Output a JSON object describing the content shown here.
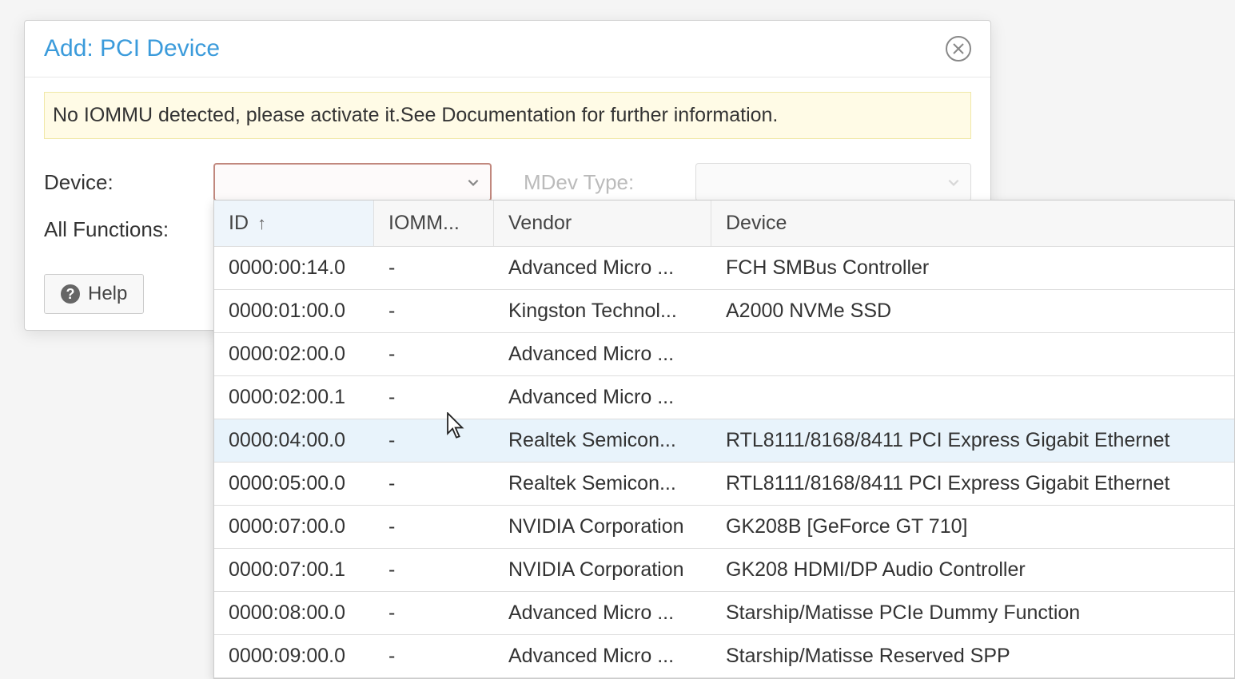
{
  "dialog": {
    "title": "Add: PCI Device",
    "warning": "No IOMMU detected, please activate it.See Documentation for further information.",
    "device_label": "Device:",
    "all_functions_label": "All Functions:",
    "mdev_type_label": "MDev Type:",
    "help_label": "Help"
  },
  "table": {
    "columns": {
      "id": "ID",
      "iommu": "IOMM...",
      "vendor": "Vendor",
      "device": "Device"
    },
    "sort_indicator": "↑",
    "rows": [
      {
        "id": "0000:00:14.0",
        "iommu": "-",
        "vendor": "Advanced Micro ...",
        "device": "FCH SMBus Controller"
      },
      {
        "id": "0000:01:00.0",
        "iommu": "-",
        "vendor": "Kingston Technol...",
        "device": "A2000 NVMe SSD"
      },
      {
        "id": "0000:02:00.0",
        "iommu": "-",
        "vendor": "Advanced Micro ...",
        "device": ""
      },
      {
        "id": "0000:02:00.1",
        "iommu": "-",
        "vendor": "Advanced Micro ...",
        "device": ""
      },
      {
        "id": "0000:04:00.0",
        "iommu": "-",
        "vendor": "Realtek Semicon...",
        "device": "RTL8111/8168/8411 PCI Express Gigabit Ethernet"
      },
      {
        "id": "0000:05:00.0",
        "iommu": "-",
        "vendor": "Realtek Semicon...",
        "device": "RTL8111/8168/8411 PCI Express Gigabit Ethernet"
      },
      {
        "id": "0000:07:00.0",
        "iommu": "-",
        "vendor": "NVIDIA Corporation",
        "device": "GK208B [GeForce GT 710]"
      },
      {
        "id": "0000:07:00.1",
        "iommu": "-",
        "vendor": "NVIDIA Corporation",
        "device": "GK208 HDMI/DP Audio Controller"
      },
      {
        "id": "0000:08:00.0",
        "iommu": "-",
        "vendor": "Advanced Micro ...",
        "device": "Starship/Matisse PCIe Dummy Function"
      },
      {
        "id": "0000:09:00.0",
        "iommu": "-",
        "vendor": "Advanced Micro ...",
        "device": "Starship/Matisse Reserved SPP"
      }
    ],
    "hovered_row_index": 4
  }
}
